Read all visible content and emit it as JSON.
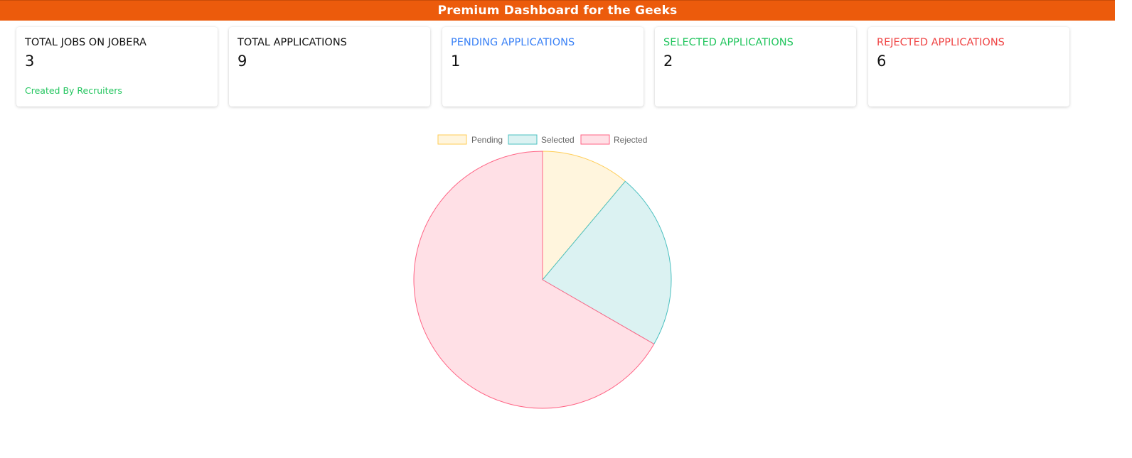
{
  "header": {
    "title": "Premium Dashboard for the Geeks",
    "bg_color": "#ec5b0c"
  },
  "cards": [
    {
      "title": "TOTAL JOBS ON JOBERA",
      "value": "3",
      "note": "Created By Recruiters",
      "title_color": "#111111",
      "note_color": "#22c55e"
    },
    {
      "title": "TOTAL APPLICATIONS",
      "value": "9",
      "title_color": "#111111"
    },
    {
      "title": "PENDING APPLICATIONS",
      "value": "1",
      "title_color": "#3b82f6"
    },
    {
      "title": "SELECTED APPLICATIONS",
      "value": "2",
      "title_color": "#22c55e"
    },
    {
      "title": "REJECTED APPLICATIONS",
      "value": "6",
      "title_color": "#ef4444"
    }
  ],
  "chart_data": {
    "type": "pie",
    "title": "",
    "legend": "top",
    "labels": [
      "Pending",
      "Selected",
      "Rejected"
    ],
    "values": [
      1,
      2,
      6
    ],
    "fill_colors": [
      "#fff5dd",
      "#dbf2f2",
      "#ffe0e6"
    ],
    "border_colors": [
      "#ffcd56",
      "#4bc0c0",
      "#ff6384"
    ]
  }
}
